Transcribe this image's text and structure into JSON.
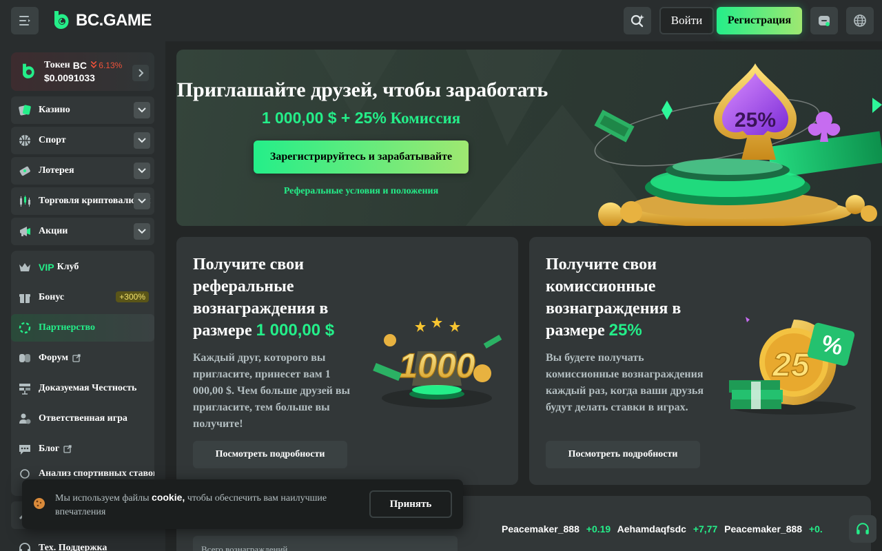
{
  "header": {
    "logo_text": "BC.GAME",
    "login_label": "Войти",
    "register_label": "Регистрация"
  },
  "sidebar": {
    "token": {
      "name_prefix": "Токен",
      "name_ticker": "BC",
      "change": "6.13%",
      "price": "$0.0091033"
    },
    "sections": [
      {
        "label": "Казино"
      },
      {
        "label": "Спорт"
      },
      {
        "label": "Лотерея"
      },
      {
        "label": "Торговля криптовалютой"
      },
      {
        "label": "Акции"
      }
    ],
    "group": {
      "vip_prefix": "VIP",
      "vip_label": "Клуб",
      "bonus_label": "Бонус",
      "bonus_badge": "+300%",
      "partner_label": "Партнерство",
      "forum_label": "Форум",
      "fairness_label": "Доказуемая Честность",
      "responsible_label": "Ответственная игра",
      "blog_label": "Блог",
      "sports_analysis_label": "Анализ спортивных ставок"
    },
    "support_label": "Тех. Поддержка"
  },
  "hero": {
    "title": "Приглашайте друзей, чтобы заработать",
    "sub_amount": "1 000,00 $ + 25%",
    "sub_word": "Комиссия",
    "cta_label": "Зарегистрируйтесь и зарабатывайте",
    "terms_link": "Реферальные условия и положения",
    "badge_text": "25%"
  },
  "cards": [
    {
      "title": "Получите свои реферальные вознаграждения в размере",
      "highlight": "1 000,00 $",
      "desc": "Каждый друг, которого вы пригласите, принесет вам 1 000,00 $. Чем больше друзей вы пригласите, тем больше вы получите!",
      "button": "Посмотреть подробности",
      "art_text": "1000"
    },
    {
      "title": "Получите свои комиссионные вознаграждения в размере",
      "highlight": "25%",
      "desc": "Вы будете получать комиссионные вознаграждения каждый раз, когда ваши друзья будут делать ставки в играх.",
      "button": "Посмотреть подробности",
      "art_text": "25"
    }
  ],
  "lower": {
    "total_label": "Всего вознаграждений"
  },
  "ticker": [
    {
      "name": "Peacemaker_888",
      "value": "+0.19"
    },
    {
      "name": "Aehamdaqfsdc",
      "value": "+7,77"
    },
    {
      "name": "Peacemaker_888",
      "value": "+0."
    }
  ],
  "cookie": {
    "text_before": "Мы используем файлы",
    "text_bold": "cookie,",
    "text_after": "чтобы обеспечить вам наилучшие впечатления",
    "accept_label": "Принять"
  },
  "colors": {
    "accent": "#24ee89",
    "background": "#232626",
    "panel": "#323738"
  }
}
